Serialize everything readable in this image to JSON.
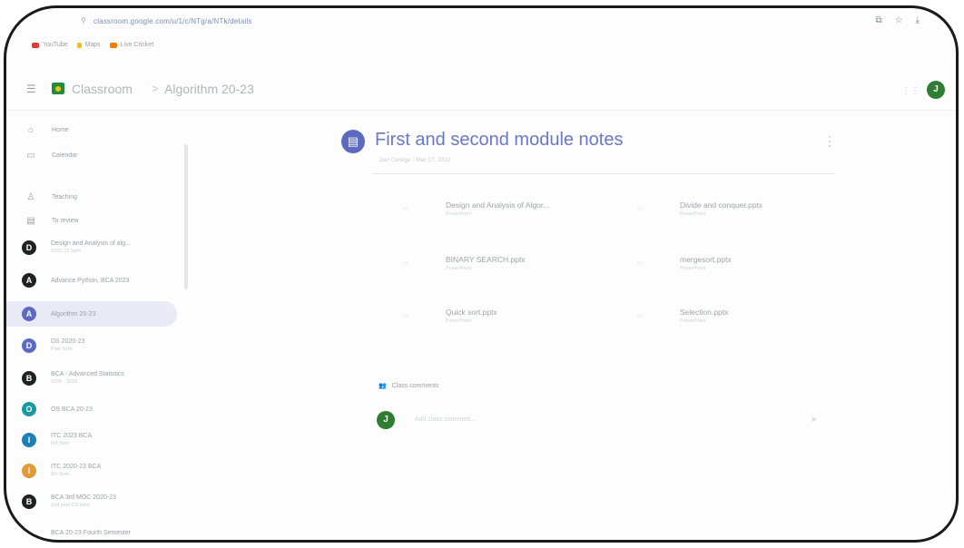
{
  "browser": {
    "url": "classroom.google.com/u/1/c/NTg/a/NTk/details",
    "bookmarks": [
      "YouTube",
      "Maps",
      "Live Cricket"
    ],
    "icons": [
      "extension-icon",
      "star-icon",
      "download-icon"
    ]
  },
  "header": {
    "app_title": "Classroom",
    "separator": ">",
    "crumb": "Algorithm 20-23",
    "avatar_letter": "J"
  },
  "sidebar": {
    "items": [
      {
        "label": "Home",
        "icon": "home-icon"
      },
      {
        "label": "Calendar",
        "icon": "calendar-icon"
      },
      {
        "label": "Teaching",
        "icon": "people-icon"
      },
      {
        "label": "To review",
        "icon": "folder-icon"
      }
    ],
    "classes": [
      {
        "letter": "D",
        "label": "Design and Analysis of alg...",
        "sub": "2022-23 Sem",
        "color": "#202124"
      },
      {
        "letter": "A",
        "label": "Advance Python, BCA 2023",
        "sub": "",
        "color": "#202124"
      },
      {
        "letter": "A",
        "label": "Algorithm 20-23",
        "sub": "",
        "color": "#5c6bc0",
        "active": true
      },
      {
        "letter": "D",
        "label": "DS 2020-23",
        "sub": "Plan Sem",
        "color": "#5c6bc0"
      },
      {
        "letter": "B",
        "label": "BCA - Advanced Statistics",
        "sub": "2020 - 2023",
        "color": "#202124"
      },
      {
        "letter": "O",
        "label": "OS BCA 20-23",
        "sub": "",
        "color": "#1a9aa0"
      },
      {
        "letter": "I",
        "label": "ITC 2023 BCA",
        "sub": "5th Sem",
        "color": "#1e7fb5"
      },
      {
        "letter": "I",
        "label": "ITC 2020-23 BCA",
        "sub": "5th Sem",
        "color": "#e09b35"
      },
      {
        "letter": "B",
        "label": "BCA 3rd MOC 2020-23",
        "sub": "2nd year CS fund",
        "color": "#202124"
      },
      {
        "letter": "",
        "label": "BCA 20-23 Fourth Semester",
        "sub": "",
        "color": "#ffffff"
      }
    ]
  },
  "main": {
    "title": "First and second module notes",
    "meta": "Joel George - Mar 17, 2022",
    "attachments": [
      {
        "name": "Design and Analysis of Algor...",
        "kind": "PowerPoint"
      },
      {
        "name": "Divide and conquer.pptx",
        "kind": "PowerPoint"
      },
      {
        "name": "BINARY SEARCH.pptx",
        "kind": "PowerPoint"
      },
      {
        "name": "mergesort.pptx",
        "kind": "PowerPoint"
      },
      {
        "name": "Quick sort.pptx",
        "kind": "PowerPoint"
      },
      {
        "name": "Selection.pptx",
        "kind": "PowerPoint"
      }
    ],
    "comments_label": "Class comments",
    "comment_placeholder": "Add class comment...",
    "comment_avatar_letter": "J"
  },
  "colors": {
    "accent": "#5c6bc0",
    "avatar": "#2e7d32",
    "classroom_green": "#1e8e3e"
  }
}
